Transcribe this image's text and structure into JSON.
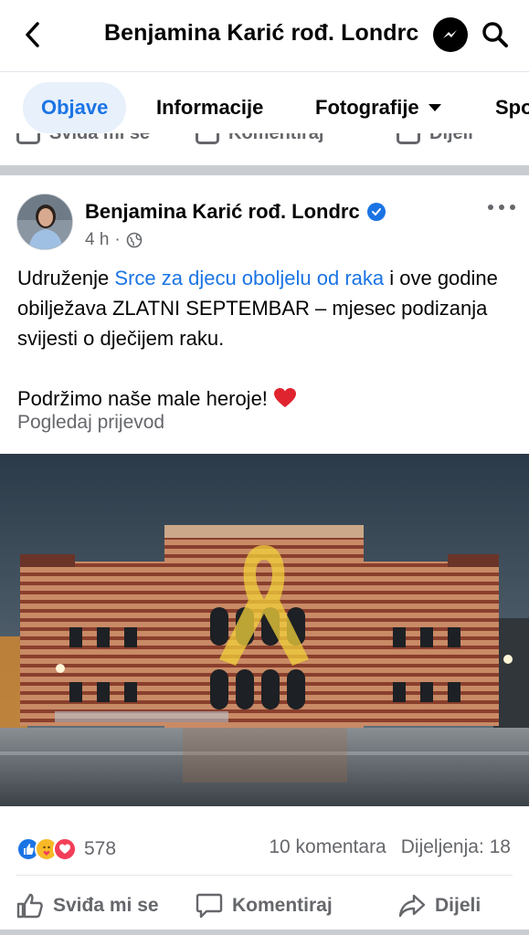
{
  "header": {
    "title": "Benjamina Karić rođ. Londrc",
    "back_icon": "chevron-left-icon",
    "messenger_icon": "messenger-icon",
    "search_icon": "search-icon"
  },
  "tabs": [
    {
      "label": "Objave",
      "active": true
    },
    {
      "label": "Informacije",
      "active": false
    },
    {
      "label": "Fotografije",
      "active": false,
      "dropdown": true
    },
    {
      "label": "Spo",
      "active": false
    }
  ],
  "prev_post_actions": {
    "like": "Sviđa mi se",
    "comment": "Komentiraj",
    "share": "Dijeli"
  },
  "post": {
    "author": "Benjamina Karić rođ. Londrc",
    "verified": true,
    "time": "4 h",
    "privacy_icon": "globe-icon",
    "text_prefix": "Udruženje ",
    "text_link": "Srce za djecu oboljelu od raka",
    "text_suffix": " i ove godine obilježava ZLATNI SEPTEMBAR – mjesec podizanja svijesti o dječijem raku.",
    "text_line2": "Podržimo naše male heroje! ",
    "translate": "Pogledaj prijevod",
    "reaction_count": "578",
    "comments": "10 komentara",
    "shares": "Dijeljenja: 18",
    "actions": {
      "like": "Sviđa mi se",
      "comment": "Komentiraj",
      "share": "Dijeli"
    }
  },
  "colors": {
    "accent": "#1b74e4",
    "muted": "#65676b",
    "active_tab_bg": "#e7f0fb",
    "separator": "#c9ccd1"
  }
}
